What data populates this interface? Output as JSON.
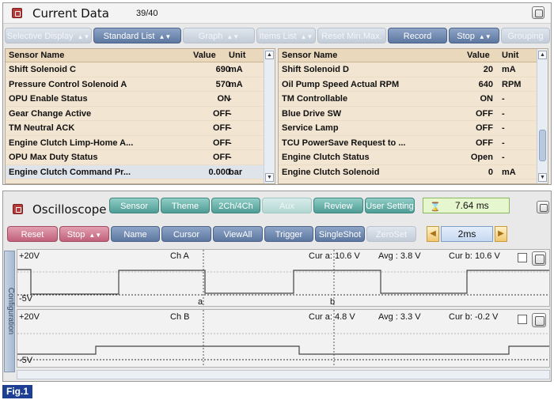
{
  "current_data": {
    "title": "Current Data",
    "counter": "39/40",
    "toolbar": [
      {
        "label": "Selective Display",
        "caret": true,
        "enabled": false
      },
      {
        "label": "Standard List",
        "caret": true,
        "enabled": true
      },
      {
        "label": "Graph",
        "caret": true,
        "enabled": false
      },
      {
        "label": "Items List",
        "caret": true,
        "enabled": false
      },
      {
        "label": "Reset Min.Max.",
        "caret": false,
        "enabled": false
      },
      {
        "label": "Record",
        "caret": false,
        "enabled": true
      },
      {
        "label": "Stop",
        "caret": true,
        "enabled": true
      },
      {
        "label": "Grouping",
        "caret": false,
        "enabled": false
      }
    ],
    "left_table": {
      "headers": {
        "name": "Sensor Name",
        "value": "Value",
        "unit": "Unit"
      },
      "rows": [
        {
          "name": "Shift Solenoid C",
          "value": "690",
          "unit": "mA"
        },
        {
          "name": "Pressure Control Solenoid A",
          "value": "570",
          "unit": "mA"
        },
        {
          "name": "OPU Enable Status",
          "value": "ON",
          "unit": "-"
        },
        {
          "name": "Gear Change Active",
          "value": "OFF",
          "unit": "-"
        },
        {
          "name": "TM Neutral ACK",
          "value": "OFF",
          "unit": "-"
        },
        {
          "name": "Engine Clutch Limp-Home A...",
          "value": "OFF",
          "unit": "-"
        },
        {
          "name": "OPU Max Duty Status",
          "value": "OFF",
          "unit": "-"
        },
        {
          "name": "Engine Clutch Command Pr...",
          "value": "0.000",
          "unit": "bar"
        }
      ]
    },
    "right_table": {
      "headers": {
        "name": "Sensor Name",
        "value": "Value",
        "unit": "Unit"
      },
      "rows": [
        {
          "name": "Shift Solenoid D",
          "value": "20",
          "unit": "mA"
        },
        {
          "name": "Oil Pump Speed Actual RPM",
          "value": "640",
          "unit": "RPM"
        },
        {
          "name": "TM Controllable",
          "value": "ON",
          "unit": "-"
        },
        {
          "name": "Blue Drive SW",
          "value": "OFF",
          "unit": "-"
        },
        {
          "name": "Service Lamp",
          "value": "OFF",
          "unit": "-"
        },
        {
          "name": "TCU PowerSave Request to ...",
          "value": "OFF",
          "unit": "-"
        },
        {
          "name": "Engine Clutch Status",
          "value": "Open",
          "unit": "-"
        },
        {
          "name": "Engine Clutch Solenoid",
          "value": "0",
          "unit": "mA"
        }
      ]
    }
  },
  "oscilloscope": {
    "title": "Oscilloscope",
    "top_buttons": [
      {
        "label": "Sensor",
        "enabled": true
      },
      {
        "label": "Theme",
        "enabled": true
      },
      {
        "label": "2Ch/4Ch",
        "enabled": true
      },
      {
        "label": "Aux",
        "enabled": false
      },
      {
        "label": "Review",
        "enabled": true
      },
      {
        "label": "User Setting",
        "enabled": true
      }
    ],
    "time_readout": "7.64 ms",
    "second_buttons": [
      {
        "label": "Reset",
        "style": "rose",
        "caret": false,
        "enabled": true
      },
      {
        "label": "Stop",
        "style": "rose",
        "caret": true,
        "enabled": true
      },
      {
        "label": "Name",
        "style": "steel",
        "caret": false,
        "enabled": true
      },
      {
        "label": "Cursor",
        "style": "steel",
        "caret": false,
        "enabled": true
      },
      {
        "label": "ViewAll",
        "style": "steel",
        "caret": false,
        "enabled": true
      },
      {
        "label": "Trigger",
        "style": "steel",
        "caret": false,
        "enabled": true
      },
      {
        "label": "SingleShot",
        "style": "steel",
        "caret": false,
        "enabled": true
      },
      {
        "label": "ZeroSet",
        "style": "steel",
        "caret": false,
        "enabled": false
      }
    ],
    "time_div": "2ms",
    "side_tab": "Configuration",
    "channels": [
      {
        "name": "Ch A",
        "top_label": "+20V",
        "bottom_label": "-5V",
        "cur_a": "Cur a: 10.6 V",
        "avg": "Avg : 3.8 V",
        "cur_b": "Cur b: 10.6 V",
        "cursor_a_label": "a",
        "cursor_b_label": "b"
      },
      {
        "name": "Ch B",
        "top_label": "+20V",
        "bottom_label": "-5V",
        "cur_a": "Cur a: 4.8 V",
        "avg": "Avg : 3.3 V",
        "cur_b": "Cur b: -0.2 V"
      }
    ]
  },
  "figure_label": "Fig.1",
  "colors": {
    "table_bg": "#f2e5d2",
    "toolbar_active": "#5d77a0",
    "scope_teal": "#4f9d95",
    "scope_rose": "#c0617a",
    "figure_badge": "#1d3f93"
  }
}
